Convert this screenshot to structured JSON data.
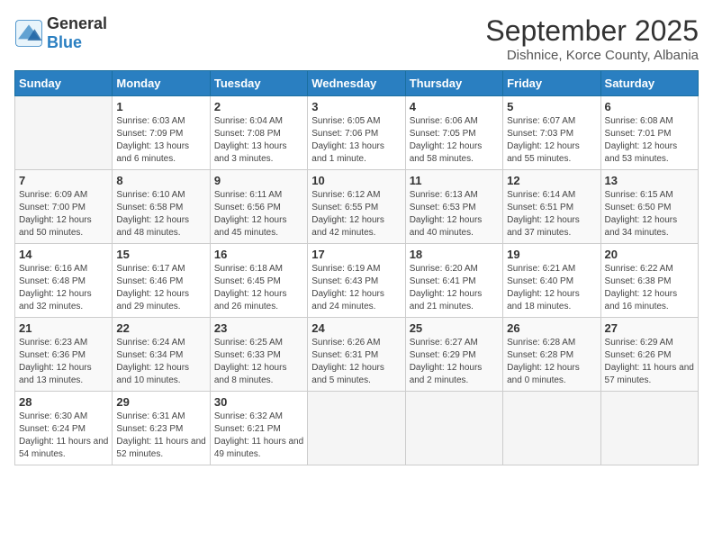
{
  "header": {
    "logo_general": "General",
    "logo_blue": "Blue",
    "month": "September 2025",
    "location": "Dishnice, Korce County, Albania"
  },
  "weekdays": [
    "Sunday",
    "Monday",
    "Tuesday",
    "Wednesday",
    "Thursday",
    "Friday",
    "Saturday"
  ],
  "weeks": [
    [
      {
        "day": "",
        "sunrise": "",
        "sunset": "",
        "daylight": ""
      },
      {
        "day": "1",
        "sunrise": "6:03 AM",
        "sunset": "7:09 PM",
        "daylight": "13 hours and 6 minutes."
      },
      {
        "day": "2",
        "sunrise": "6:04 AM",
        "sunset": "7:08 PM",
        "daylight": "13 hours and 3 minutes."
      },
      {
        "day": "3",
        "sunrise": "6:05 AM",
        "sunset": "7:06 PM",
        "daylight": "13 hours and 1 minute."
      },
      {
        "day": "4",
        "sunrise": "6:06 AM",
        "sunset": "7:05 PM",
        "daylight": "12 hours and 58 minutes."
      },
      {
        "day": "5",
        "sunrise": "6:07 AM",
        "sunset": "7:03 PM",
        "daylight": "12 hours and 55 minutes."
      },
      {
        "day": "6",
        "sunrise": "6:08 AM",
        "sunset": "7:01 PM",
        "daylight": "12 hours and 53 minutes."
      }
    ],
    [
      {
        "day": "7",
        "sunrise": "6:09 AM",
        "sunset": "7:00 PM",
        "daylight": "12 hours and 50 minutes."
      },
      {
        "day": "8",
        "sunrise": "6:10 AM",
        "sunset": "6:58 PM",
        "daylight": "12 hours and 48 minutes."
      },
      {
        "day": "9",
        "sunrise": "6:11 AM",
        "sunset": "6:56 PM",
        "daylight": "12 hours and 45 minutes."
      },
      {
        "day": "10",
        "sunrise": "6:12 AM",
        "sunset": "6:55 PM",
        "daylight": "12 hours and 42 minutes."
      },
      {
        "day": "11",
        "sunrise": "6:13 AM",
        "sunset": "6:53 PM",
        "daylight": "12 hours and 40 minutes."
      },
      {
        "day": "12",
        "sunrise": "6:14 AM",
        "sunset": "6:51 PM",
        "daylight": "12 hours and 37 minutes."
      },
      {
        "day": "13",
        "sunrise": "6:15 AM",
        "sunset": "6:50 PM",
        "daylight": "12 hours and 34 minutes."
      }
    ],
    [
      {
        "day": "14",
        "sunrise": "6:16 AM",
        "sunset": "6:48 PM",
        "daylight": "12 hours and 32 minutes."
      },
      {
        "day": "15",
        "sunrise": "6:17 AM",
        "sunset": "6:46 PM",
        "daylight": "12 hours and 29 minutes."
      },
      {
        "day": "16",
        "sunrise": "6:18 AM",
        "sunset": "6:45 PM",
        "daylight": "12 hours and 26 minutes."
      },
      {
        "day": "17",
        "sunrise": "6:19 AM",
        "sunset": "6:43 PM",
        "daylight": "12 hours and 24 minutes."
      },
      {
        "day": "18",
        "sunrise": "6:20 AM",
        "sunset": "6:41 PM",
        "daylight": "12 hours and 21 minutes."
      },
      {
        "day": "19",
        "sunrise": "6:21 AM",
        "sunset": "6:40 PM",
        "daylight": "12 hours and 18 minutes."
      },
      {
        "day": "20",
        "sunrise": "6:22 AM",
        "sunset": "6:38 PM",
        "daylight": "12 hours and 16 minutes."
      }
    ],
    [
      {
        "day": "21",
        "sunrise": "6:23 AM",
        "sunset": "6:36 PM",
        "daylight": "12 hours and 13 minutes."
      },
      {
        "day": "22",
        "sunrise": "6:24 AM",
        "sunset": "6:34 PM",
        "daylight": "12 hours and 10 minutes."
      },
      {
        "day": "23",
        "sunrise": "6:25 AM",
        "sunset": "6:33 PM",
        "daylight": "12 hours and 8 minutes."
      },
      {
        "day": "24",
        "sunrise": "6:26 AM",
        "sunset": "6:31 PM",
        "daylight": "12 hours and 5 minutes."
      },
      {
        "day": "25",
        "sunrise": "6:27 AM",
        "sunset": "6:29 PM",
        "daylight": "12 hours and 2 minutes."
      },
      {
        "day": "26",
        "sunrise": "6:28 AM",
        "sunset": "6:28 PM",
        "daylight": "12 hours and 0 minutes."
      },
      {
        "day": "27",
        "sunrise": "6:29 AM",
        "sunset": "6:26 PM",
        "daylight": "11 hours and 57 minutes."
      }
    ],
    [
      {
        "day": "28",
        "sunrise": "6:30 AM",
        "sunset": "6:24 PM",
        "daylight": "11 hours and 54 minutes."
      },
      {
        "day": "29",
        "sunrise": "6:31 AM",
        "sunset": "6:23 PM",
        "daylight": "11 hours and 52 minutes."
      },
      {
        "day": "30",
        "sunrise": "6:32 AM",
        "sunset": "6:21 PM",
        "daylight": "11 hours and 49 minutes."
      },
      {
        "day": "",
        "sunrise": "",
        "sunset": "",
        "daylight": ""
      },
      {
        "day": "",
        "sunrise": "",
        "sunset": "",
        "daylight": ""
      },
      {
        "day": "",
        "sunrise": "",
        "sunset": "",
        "daylight": ""
      },
      {
        "day": "",
        "sunrise": "",
        "sunset": "",
        "daylight": ""
      }
    ]
  ],
  "sunrise_label": "Sunrise:",
  "sunset_label": "Sunset:",
  "daylight_label": "Daylight:"
}
